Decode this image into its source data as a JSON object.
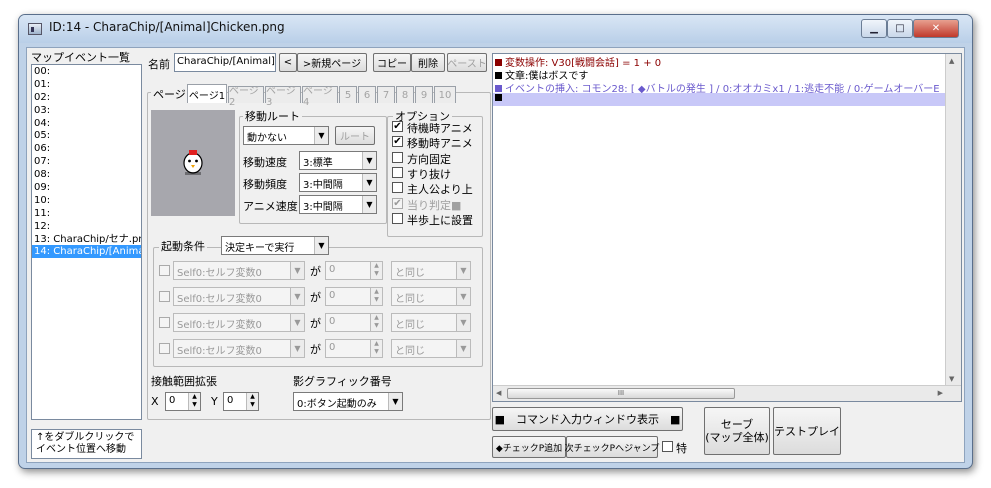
{
  "window": {
    "title": "ID:14 - CharaChip/[Animal]Chicken.png",
    "minimize_glyph": "▁",
    "maximize_glyph": "□",
    "close_glyph": "✕"
  },
  "event_list": {
    "header": "マップイベント一覧",
    "items": [
      "00:",
      "01:",
      "02:",
      "03:",
      "04:",
      "05:",
      "06:",
      "07:",
      "08:",
      "09:",
      "10:",
      "11:",
      "12:",
      "13: CharaChip/セナ.pn",
      "14: CharaChip/[Animal"
    ],
    "selected_index": 14,
    "hint": "↑をダブルクリックで\nイベント位置へ移動"
  },
  "top": {
    "name_label": "名前",
    "name_value": "CharaChip/[Animal]Chicken",
    "prev_button": "<",
    "new_page_button": ">新規ページ",
    "copy_button": "コピー",
    "delete_button": "削除",
    "paste_button": "ペースト"
  },
  "pages": {
    "group_label": "ページ",
    "tabs": [
      "ページ1",
      "ページ2",
      "ページ3",
      "ページ4",
      "5",
      "6",
      "7",
      "8",
      "9",
      "10"
    ],
    "selected": 0
  },
  "movement": {
    "label": "移動ルート",
    "type_value": "動かない",
    "route_button": "ルート",
    "speed_label": "移動速度",
    "speed_value": "3:標準",
    "freq_label": "移動頻度",
    "freq_value": "3:中間隔",
    "anim_label": "アニメ速度",
    "anim_value": "3:中間隔"
  },
  "options": {
    "label": "オプション",
    "items": [
      {
        "label": "待機時アニメ",
        "checked": true,
        "disabled": false
      },
      {
        "label": "移動時アニメ",
        "checked": true,
        "disabled": false
      },
      {
        "label": "方向固定",
        "checked": false,
        "disabled": false
      },
      {
        "label": "すり抜け",
        "checked": false,
        "disabled": false
      },
      {
        "label": "主人公より上",
        "checked": false,
        "disabled": false
      },
      {
        "label": "当り判定■",
        "checked": true,
        "disabled": true
      },
      {
        "label": "半歩上に設置",
        "checked": false,
        "disabled": false
      }
    ]
  },
  "trigger": {
    "label": "起動条件",
    "value": "決定キーで実行",
    "rows": [
      {
        "var": "Self0:セルフ変数0",
        "ga": "が",
        "num": "0",
        "cmp": "と同じ"
      },
      {
        "var": "Self0:セルフ変数0",
        "ga": "が",
        "num": "0",
        "cmp": "と同じ"
      },
      {
        "var": "Self0:セルフ変数0",
        "ga": "が",
        "num": "0",
        "cmp": "と同じ"
      },
      {
        "var": "Self0:セルフ変数0",
        "ga": "が",
        "num": "0",
        "cmp": "と同じ"
      }
    ]
  },
  "contact": {
    "label": "接触範囲拡張",
    "x_label": "X",
    "x_value": "0",
    "y_label": "Y",
    "y_value": "0"
  },
  "shadow": {
    "label": "影グラフィック番号",
    "value": "0:ボタン起動のみ"
  },
  "commands": {
    "lines": [
      {
        "text": "変数操作: V30[戦闘会話] = 1 + 0",
        "color": "#8b0000",
        "mark": "#8b0000"
      },
      {
        "text": "文章:僕はボスです",
        "color": "#000000",
        "mark": "#000000"
      },
      {
        "text": "イベントの挿入: コモン28: [ ◆バトルの発生 ] / 0:オオカミx1 / 1:逃走不能 / 0:ゲームオーバーE",
        "color": "#6a5acd",
        "mark": "#6a5acd"
      },
      {
        "text": "",
        "color": "#000000",
        "mark": "#000000"
      }
    ],
    "scroll_grip": "III"
  },
  "bottom": {
    "cmd_window_button": "■　コマンド入力ウィンドウ表示　■",
    "save_button": "セーブ\n(マップ全体)",
    "testplay_button": "テストプレイ",
    "checkp_add_button": "◆チェックP追加",
    "checkp_jump_button": "次チェックPへジャンプ",
    "special_label": "特"
  },
  "colors": {
    "selection": "#3399ff",
    "command_highlight": "#c8c8f8"
  }
}
